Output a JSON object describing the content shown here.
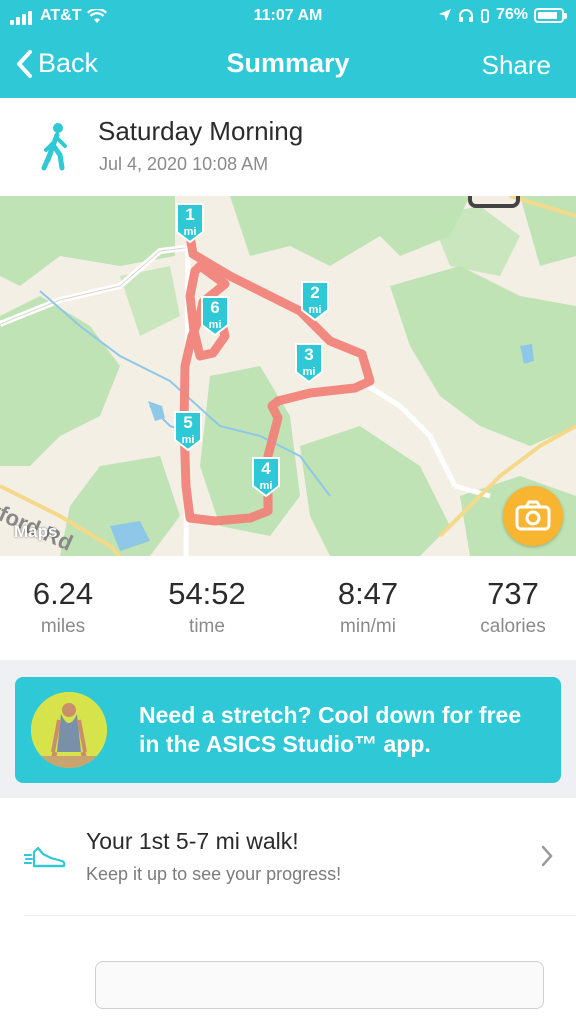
{
  "status_bar": {
    "carrier": "AT&T",
    "time": "11:07 AM",
    "battery": "76%"
  },
  "nav": {
    "back_label": "Back",
    "title": "Summary",
    "share_label": "Share"
  },
  "activity": {
    "title": "Saturday Morning",
    "date": "Jul 4, 2020 10:08 AM",
    "icon": "walking-person-icon"
  },
  "map": {
    "attribution": "Maps",
    "road_label": "yford Rd",
    "route_color": "#f0837a",
    "mile_markers": [
      {
        "number": "1",
        "unit": "mi"
      },
      {
        "number": "2",
        "unit": "mi"
      },
      {
        "number": "3",
        "unit": "mi"
      },
      {
        "number": "4",
        "unit": "mi"
      },
      {
        "number": "5",
        "unit": "mi"
      },
      {
        "number": "6",
        "unit": "mi"
      }
    ]
  },
  "stats": [
    {
      "value": "6.24",
      "label": "miles"
    },
    {
      "value": "54:52",
      "label": "time"
    },
    {
      "value": "8:47",
      "label": "min/mi"
    },
    {
      "value": "737",
      "label": "calories"
    }
  ],
  "promo": {
    "text": "Need a stretch? Cool down for free in the ASICS Studio™ app."
  },
  "milestone": {
    "title": "Your 1st 5-7 mi walk!",
    "subtitle": "Keep it up to see your progress!"
  },
  "colors": {
    "accent": "#2fc8d6",
    "camera": "#f8b532",
    "map_green": "#bfe3b4",
    "map_land": "#f3efe5"
  }
}
